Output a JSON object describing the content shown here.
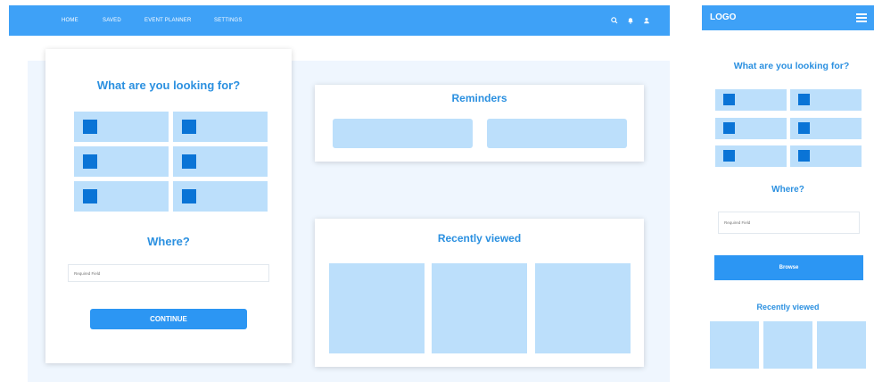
{
  "desktop": {
    "nav": {
      "links": [
        "HOME",
        "SAVED",
        "EVENT PLANNER",
        "SETTINGS"
      ],
      "icons": [
        "search-icon",
        "bell-icon",
        "user-icon"
      ]
    },
    "search_card": {
      "heading": "What are you looking for?",
      "category_tiles": 6,
      "where_heading": "Where?",
      "where_placeholder": "Required Field",
      "continue_label": "CONTINUE"
    },
    "reminders": {
      "title": "Reminders",
      "items": 2
    },
    "recently_viewed": {
      "title": "Recently viewed",
      "items": 3
    }
  },
  "mobile": {
    "logo": "LOGO",
    "menu_icon": "hamburger-menu-icon",
    "heading": "What are you looking for?",
    "category_tiles": 6,
    "where_heading": "Where?",
    "where_placeholder": "Required Field",
    "browse_label": "Browse",
    "recent_title": "Recently viewed",
    "recent_items": 3
  },
  "colors": {
    "primary": "#3ea1f7",
    "button": "#2c96f3",
    "heading": "#2b90e0",
    "tile": "#bcdffb",
    "tile_square": "#0a74d6",
    "canvas": "#eff6fe"
  }
}
